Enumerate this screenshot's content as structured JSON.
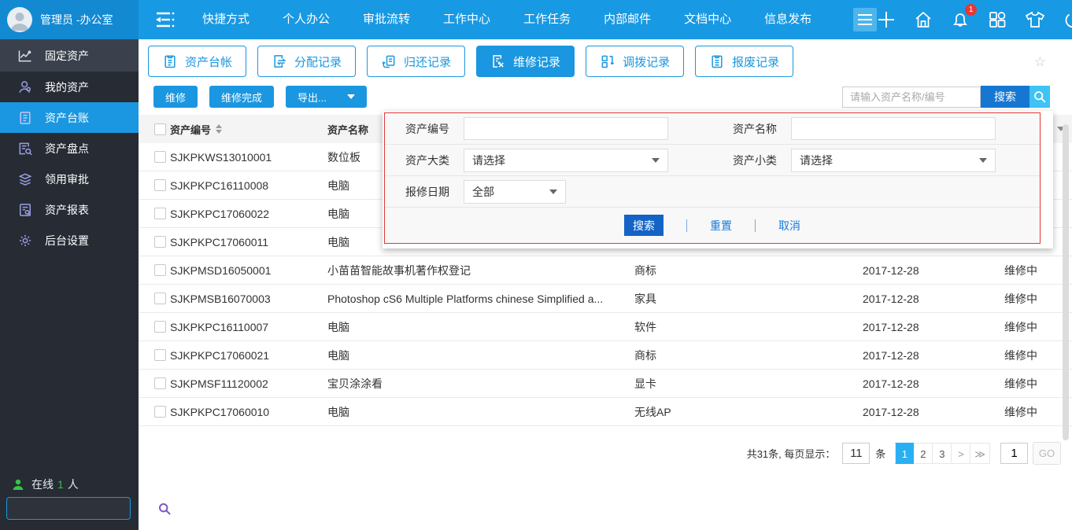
{
  "topbar": {
    "user_name": "管理员 -办公室",
    "menu": [
      {
        "label": "快捷方式"
      },
      {
        "label": "个人办公"
      },
      {
        "label": "审批流转"
      },
      {
        "label": "工作中心"
      },
      {
        "label": "工作任务"
      },
      {
        "label": "内部邮件"
      },
      {
        "label": "文档中心"
      },
      {
        "label": "信息发布"
      }
    ],
    "notification_badge": "1"
  },
  "sidebar": {
    "items": [
      {
        "label": "固定资产",
        "icon": "chart-icon",
        "header": true
      },
      {
        "label": "我的资产",
        "icon": "person-icon"
      },
      {
        "label": "资产台账",
        "icon": "ledger-icon",
        "active": true
      },
      {
        "label": "资产盘点",
        "icon": "inventory-icon"
      },
      {
        "label": "领用审批",
        "icon": "approval-icon"
      },
      {
        "label": "资产报表",
        "icon": "report-icon"
      },
      {
        "label": "后台设置",
        "icon": "gear-icon"
      }
    ],
    "online_prefix": "在线",
    "online_count": "1",
    "online_suffix": "人"
  },
  "tabs": [
    {
      "label": "资产台帐",
      "icon": "ledger-tab-icon"
    },
    {
      "label": "分配记录",
      "icon": "assign-icon"
    },
    {
      "label": "归还记录",
      "icon": "return-icon"
    },
    {
      "label": "维修记录",
      "icon": "repair-icon",
      "active": true
    },
    {
      "label": "调拨记录",
      "icon": "transfer-icon"
    },
    {
      "label": "报废记录",
      "icon": "scrap-icon"
    }
  ],
  "toolbar": {
    "repair_label": "维修",
    "repair_done_label": "维修完成",
    "export_label": "导出...",
    "search_placeholder": "请输入资产名称/编号",
    "search_label": "搜索"
  },
  "filter_panel": {
    "asset_code_label": "资产编号",
    "asset_name_label": "资产名称",
    "category_label": "资产大类",
    "subcategory_label": "资产小类",
    "repair_date_label": "报修日期",
    "category_value": "请选择",
    "subcategory_value": "请选择",
    "repair_date_value": "全部",
    "search_label": "搜索",
    "reset_label": "重置",
    "cancel_label": "取消"
  },
  "table": {
    "header_code": "资产编号",
    "header_name": "资产名称",
    "rows": [
      {
        "code": "SJKPKWS13010001",
        "name": "数位板",
        "category": "",
        "date": "",
        "status": ""
      },
      {
        "code": "SJKPKPC16110008",
        "name": "电脑",
        "category": "",
        "date": "",
        "status": ""
      },
      {
        "code": "SJKPKPC17060022",
        "name": "电脑",
        "category": "",
        "date": "",
        "status": ""
      },
      {
        "code": "SJKPKPC17060011",
        "name": "电脑",
        "category": "",
        "date": "",
        "status": ""
      },
      {
        "code": "SJKPMSD16050001",
        "name": "小苗苗智能故事机著作权登记",
        "category": "商标",
        "date": "2017-12-28",
        "status": "维修中"
      },
      {
        "code": "SJKPMSB16070003",
        "name": "Photoshop cS6 Multiple Platforms chinese Simplified a...",
        "category": "家具",
        "date": "2017-12-28",
        "status": "维修中"
      },
      {
        "code": "SJKPKPC16110007",
        "name": "电脑",
        "category": "软件",
        "date": "2017-12-28",
        "status": "维修中"
      },
      {
        "code": "SJKPKPC17060021",
        "name": "电脑",
        "category": "商标",
        "date": "2017-12-28",
        "status": "维修中"
      },
      {
        "code": "SJKPMSF11120002",
        "name": "宝贝涂涂看",
        "category": "显卡",
        "date": "2017-12-28",
        "status": "维修中"
      },
      {
        "code": "SJKPKPC17060010",
        "name": "电脑",
        "category": "无线AP",
        "date": "2017-12-28",
        "status": "维修中"
      }
    ]
  },
  "pagination": {
    "summary": "共31条, 每页显示：",
    "page_size": "11",
    "unit": "条",
    "pages": [
      {
        "label": "1",
        "active": true
      },
      {
        "label": "2"
      },
      {
        "label": "3"
      },
      {
        "label": ">",
        "arrow": true
      },
      {
        "label": "≫",
        "arrow": true
      }
    ],
    "goto_value": "1",
    "go_label": "GO"
  }
}
